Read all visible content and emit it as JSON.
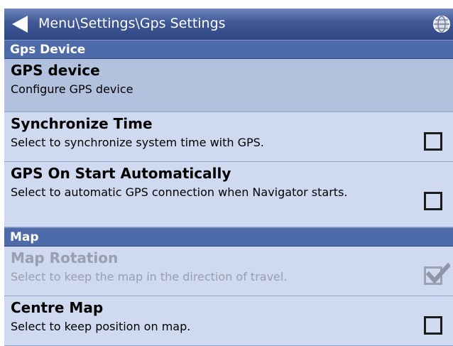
{
  "titlebar": {
    "title": "Menu\\Settings\\Gps Settings",
    "back_icon": "back-arrow-icon",
    "globe_icon": "globe-icon"
  },
  "sections": [
    {
      "header": "Gps Device",
      "items": [
        {
          "label": "GPS device",
          "description": "Configure GPS device",
          "checkbox": null,
          "state": "selected"
        },
        {
          "label": "Synchronize Time",
          "description": "Select to synchronize system time with GPS.",
          "checkbox": false,
          "state": "normal"
        },
        {
          "label": "GPS On Start Automatically",
          "description": "Select to automatic GPS connection when Navigator starts.",
          "checkbox": false,
          "state": "normal"
        }
      ]
    },
    {
      "header": "Map",
      "items": [
        {
          "label": "Map Rotation",
          "description": "Select to keep the map in the direction of travel.",
          "checkbox": true,
          "state": "disabled"
        },
        {
          "label": "Centre Map",
          "description": "Select to keep position on map.",
          "checkbox": false,
          "state": "normal"
        }
      ]
    }
  ],
  "colors": {
    "titlebar": "#3f5896",
    "section_header": "#4d6aa9",
    "list_background": "#cfd9ef",
    "selected_row": "#b2c1de",
    "disabled_text": "#97a0b0"
  }
}
